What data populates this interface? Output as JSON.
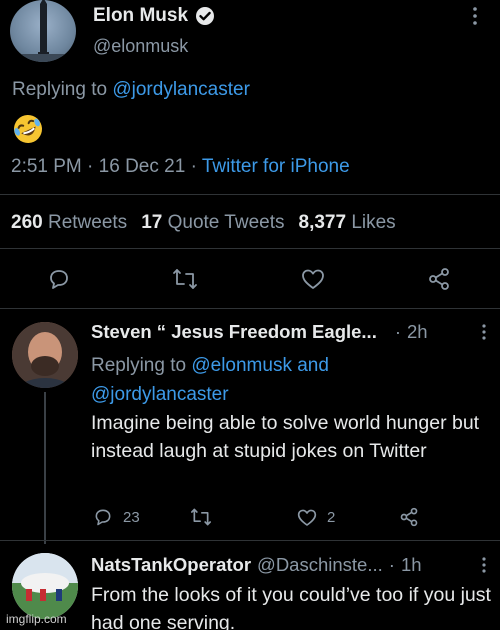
{
  "main_tweet": {
    "author_name": "Elon Musk",
    "handle": "@elonmusk",
    "replying_prefix": "Replying to",
    "replying_to": "@jordylancaster",
    "emoji": "rolling-on-floor-laughing",
    "time": "2:51 PM",
    "date": "16 Dec 21",
    "source": "Twitter for iPhone",
    "separator": "·",
    "stats": {
      "retweets_count": "260",
      "retweets_label": "Retweets",
      "quotes_count": "17",
      "quotes_label": "Quote Tweets",
      "likes_count": "8,377",
      "likes_label": "Likes"
    }
  },
  "replies": [
    {
      "author_name": "Steven “ Jesus Freedom Eagle...",
      "time_ago": "2h",
      "replying_prefix": "Replying to",
      "replying_to_1": "@elonmusk and",
      "replying_to_2": "@jordylancaster",
      "text": "Imagine being able to solve world hunger but instead laugh at stupid jokes on Twitter",
      "reply_count": "23",
      "retweet_count": "",
      "like_count": "2"
    },
    {
      "author_name": "NatsTankOperator",
      "handle": "@Daschinste...",
      "time_ago": "1h",
      "text": "From the looks of it you could’ve too if you just had one serving."
    }
  ],
  "watermark": "imgflip.com",
  "colors": {
    "background": "#000000",
    "text": "#e7e9ea",
    "muted": "#8b98a5",
    "link": "#3d9ae8",
    "divider": "#2f3336"
  }
}
